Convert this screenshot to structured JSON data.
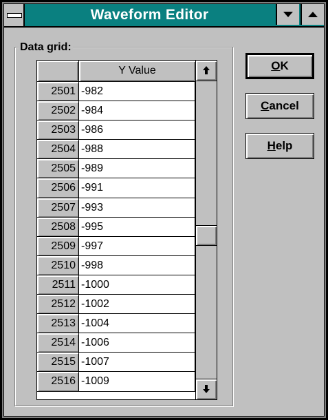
{
  "window": {
    "title": "Waveform Editor"
  },
  "group": {
    "label": "Data grid:"
  },
  "grid": {
    "column_header": "Y Value",
    "rows": [
      {
        "index": "2501",
        "value": "-982"
      },
      {
        "index": "2502",
        "value": "-984"
      },
      {
        "index": "2503",
        "value": "-986"
      },
      {
        "index": "2504",
        "value": "-988"
      },
      {
        "index": "2505",
        "value": "-989"
      },
      {
        "index": "2506",
        "value": "-991"
      },
      {
        "index": "2507",
        "value": "-993"
      },
      {
        "index": "2508",
        "value": "-995"
      },
      {
        "index": "2509",
        "value": "-997"
      },
      {
        "index": "2510",
        "value": "-998"
      },
      {
        "index": "2511",
        "value": "-1000"
      },
      {
        "index": "2512",
        "value": "-1002"
      },
      {
        "index": "2513",
        "value": "-1004"
      },
      {
        "index": "2514",
        "value": "-1006"
      },
      {
        "index": "2515",
        "value": "-1007"
      },
      {
        "index": "2516",
        "value": "-1009"
      }
    ],
    "scroll_position": 0.52
  },
  "buttons": {
    "ok": {
      "mnemonic": "O",
      "rest": "K"
    },
    "cancel": {
      "mnemonic": "C",
      "rest": "ancel"
    },
    "help": {
      "mnemonic": "H",
      "rest": "elp"
    }
  },
  "icons": {
    "system_menu": "system-menu-icon",
    "minimize": "minimize-icon",
    "maximize": "maximize-icon",
    "scroll_up": "scroll-up-arrow-icon",
    "scroll_down": "scroll-down-arrow-icon"
  },
  "colors": {
    "titlebar": "#0a8080",
    "face": "#c0c0c0"
  }
}
